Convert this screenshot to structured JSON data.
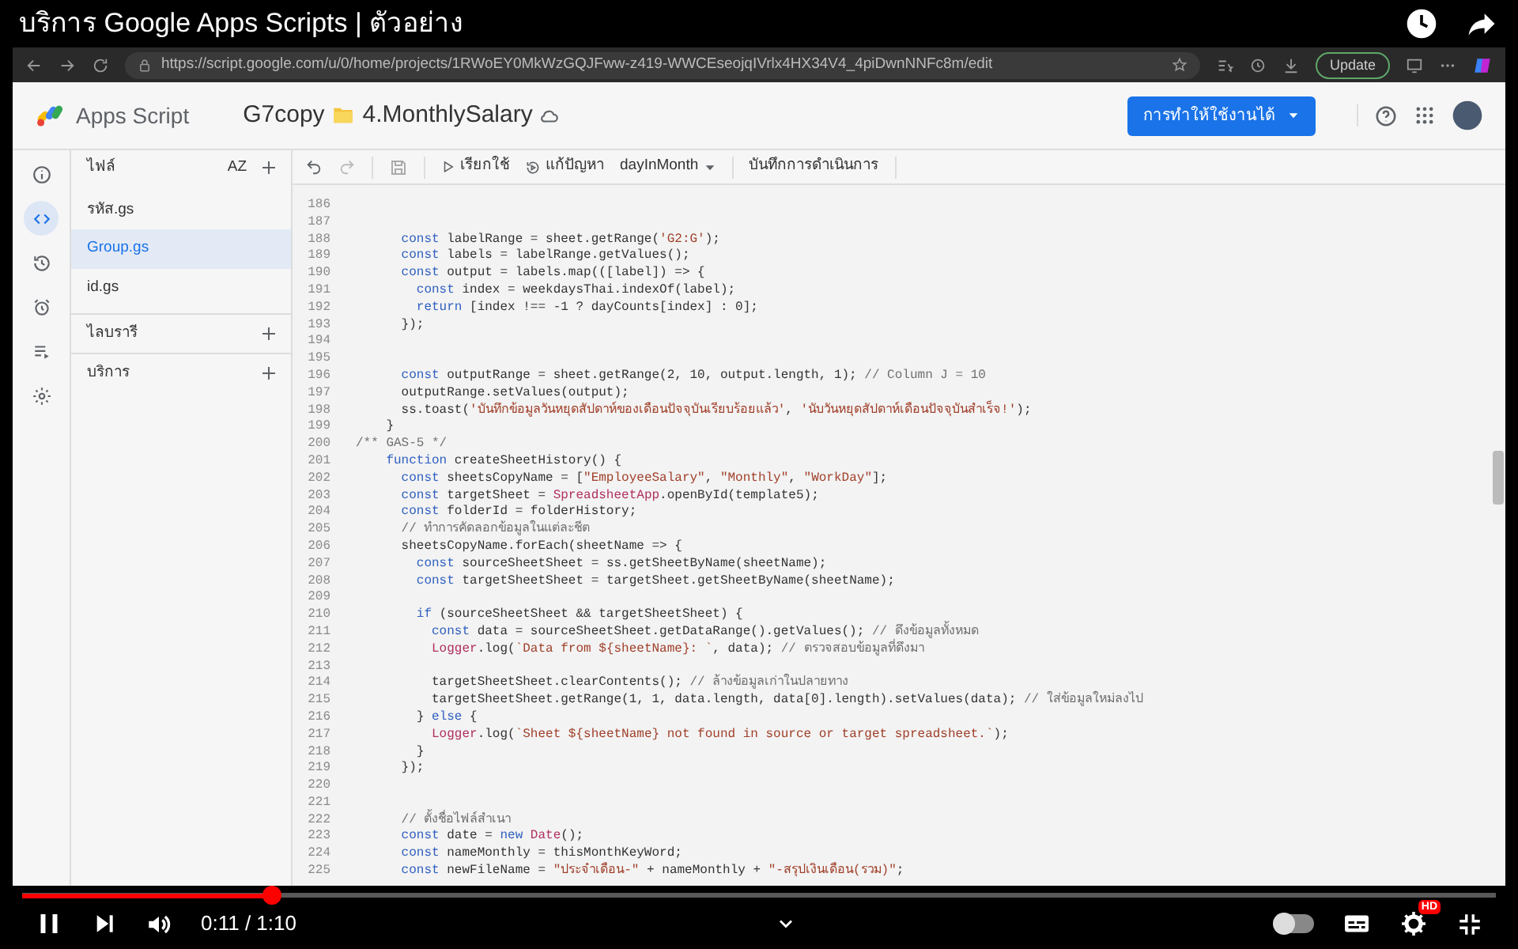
{
  "video": {
    "title": "บริการ Google Apps Scripts | ตัวอย่าง",
    "time": "0:11 / 1:10",
    "progress": {
      "level": 0.17
    },
    "autoplay": {
      "on": false
    },
    "hd_badge": "HD"
  },
  "browser": {
    "url": "https://script.google.com/u/0/home/projects/1RWoEY0MkWzGQJFww-z419-WWCEseojqIVrlx4HX34V4_4piDwnNNFc8m/edit",
    "update_button": "Update"
  },
  "app": {
    "product": "Apps Script",
    "project_prefix": "G7copy",
    "project_name": "4.MonthlySalary",
    "deploy_button": "การทำให้ใช้งานได้"
  },
  "rail": [
    {
      "kind": "overview",
      "selected": false
    },
    {
      "kind": "editor",
      "selected": true
    },
    {
      "kind": "history",
      "selected": false
    },
    {
      "kind": "triggers",
      "selected": false
    },
    {
      "kind": "executions",
      "selected": false
    },
    {
      "kind": "settings",
      "selected": false
    }
  ],
  "files": {
    "heading": "ไฟล์",
    "sort_button": "AZ",
    "items": [
      {
        "name": "รหัส.gs",
        "selected": false
      },
      {
        "name": "Group.gs",
        "selected": true
      },
      {
        "name": "id.gs",
        "selected": false
      }
    ],
    "sections": [
      {
        "label": "ไลบรารี"
      },
      {
        "label": "บริการ"
      }
    ]
  },
  "toolbar": {
    "run": "เรียกใช้",
    "debug": "แก้ปัญหา",
    "function": "dayInMonth",
    "log": "บันทึกการดำเนินการ"
  },
  "code": [
    {
      "n": "186"
    },
    {
      "n": "187"
    },
    {
      "n": "188",
      "parts": [
        {
          "kind": "keyword",
          "text": "      const"
        },
        {
          "kind": "plain",
          "text": " labelRange = sheet.getRange("
        },
        {
          "kind": "string",
          "text": "'G2:G'"
        },
        {
          "kind": "plain",
          "text": ");"
        }
      ]
    },
    {
      "n": "189",
      "parts": [
        {
          "kind": "keyword",
          "text": "      const"
        },
        {
          "kind": "plain",
          "text": " labels = labelRange.getValues();"
        }
      ]
    },
    {
      "n": "190",
      "parts": [
        {
          "kind": "keyword",
          "text": "      const"
        },
        {
          "kind": "plain",
          "text": " output = labels.map(([label]) => {"
        }
      ]
    },
    {
      "n": "191",
      "parts": [
        {
          "kind": "keyword",
          "text": "        const"
        },
        {
          "kind": "plain",
          "text": " index = weekdaysThai.indexOf(label);"
        }
      ]
    },
    {
      "n": "192",
      "parts": [
        {
          "kind": "keyword",
          "text": "        return"
        },
        {
          "kind": "plain",
          "text": " [index !== -1 ? dayCounts[index] : 0];"
        }
      ]
    },
    {
      "n": "193",
      "parts": [
        {
          "kind": "plain",
          "text": "      });"
        }
      ]
    },
    {
      "n": "194"
    },
    {
      "n": "195"
    },
    {
      "n": "196",
      "parts": [
        {
          "kind": "keyword",
          "text": "      const"
        },
        {
          "kind": "plain",
          "text": " outputRange = sheet.getRange(2, 10, output.length, 1); "
        },
        {
          "kind": "comment",
          "text": "// Column J = 10"
        }
      ]
    },
    {
      "n": "197",
      "parts": [
        {
          "kind": "plain",
          "text": "      outputRange.setValues(output);"
        }
      ]
    },
    {
      "n": "198",
      "parts": [
        {
          "kind": "plain",
          "text": "      ss.toast("
        },
        {
          "kind": "string",
          "text": "'บันทึกข้อมูลวันหยุดสัปดาห์ของเดือนปัจจุบันเรียบร้อยแล้ว'"
        },
        {
          "kind": "plain",
          "text": ", "
        },
        {
          "kind": "string",
          "text": "'นับวันหยุดสัปดาห์เดือนปัจจุบันสำเร็จ!'"
        },
        {
          "kind": "plain",
          "text": ");"
        }
      ]
    },
    {
      "n": "199",
      "parts": [
        {
          "kind": "plain",
          "text": "    }"
        }
      ]
    },
    {
      "n": "200",
      "parts": [
        {
          "kind": "comment",
          "text": "/** GAS-5 */"
        }
      ]
    },
    {
      "n": "201",
      "parts": [
        {
          "kind": "keyword",
          "text": "    function"
        },
        {
          "kind": "plain",
          "text": " createSheetHistory() {"
        }
      ]
    },
    {
      "n": "202",
      "parts": [
        {
          "kind": "keyword",
          "text": "      const"
        },
        {
          "kind": "plain",
          "text": " sheetsCopyName = ["
        },
        {
          "kind": "string",
          "text": "\"EmployeeSalary\""
        },
        {
          "kind": "plain",
          "text": ", "
        },
        {
          "kind": "string",
          "text": "\"Monthly\""
        },
        {
          "kind": "plain",
          "text": ", "
        },
        {
          "kind": "string",
          "text": "\"WorkDay\""
        },
        {
          "kind": "plain",
          "text": "];"
        }
      ]
    },
    {
      "n": "203",
      "parts": [
        {
          "kind": "keyword",
          "text": "      const"
        },
        {
          "kind": "plain",
          "text": " targetSheet = "
        },
        {
          "kind": "type",
          "text": "SpreadsheetApp"
        },
        {
          "kind": "plain",
          "text": ".openById(template5);"
        }
      ]
    },
    {
      "n": "204",
      "parts": [
        {
          "kind": "keyword",
          "text": "      const"
        },
        {
          "kind": "plain",
          "text": " folderId = folderHistory;"
        }
      ]
    },
    {
      "n": "205",
      "parts": [
        {
          "kind": "comment",
          "text": "      // ทำการคัดลอกข้อมูลในแต่ละชีต"
        }
      ]
    },
    {
      "n": "206",
      "parts": [
        {
          "kind": "plain",
          "text": "      sheetsCopyName.forEach(sheetName => {"
        }
      ]
    },
    {
      "n": "207",
      "parts": [
        {
          "kind": "keyword",
          "text": "        const"
        },
        {
          "kind": "plain",
          "text": " sourceSheetSheet = ss.getSheetByName(sheetName);"
        }
      ]
    },
    {
      "n": "208",
      "parts": [
        {
          "kind": "keyword",
          "text": "        const"
        },
        {
          "kind": "plain",
          "text": " targetSheetSheet = targetSheet.getSheetByName(sheetName);"
        }
      ]
    },
    {
      "n": "209"
    },
    {
      "n": "210",
      "parts": [
        {
          "kind": "keyword",
          "text": "        if"
        },
        {
          "kind": "plain",
          "text": " (sourceSheetSheet && targetSheetSheet) {"
        }
      ]
    },
    {
      "n": "211",
      "parts": [
        {
          "kind": "keyword",
          "text": "          const"
        },
        {
          "kind": "plain",
          "text": " data = sourceSheetSheet.getDataRange().getValues(); "
        },
        {
          "kind": "comment",
          "text": "// ดึงข้อมูลทั้งหมด"
        }
      ]
    },
    {
      "n": "212",
      "parts": [
        {
          "kind": "type",
          "text": "          Logger"
        },
        {
          "kind": "plain",
          "text": ".log("
        },
        {
          "kind": "string",
          "text": "`Data from ${sheetName}: `"
        },
        {
          "kind": "plain",
          "text": ", data); "
        },
        {
          "kind": "comment",
          "text": "// ตรวจสอบข้อมูลที่ดึงมา"
        }
      ]
    },
    {
      "n": "213"
    },
    {
      "n": "214",
      "parts": [
        {
          "kind": "plain",
          "text": "          targetSheetSheet.clearContents(); "
        },
        {
          "kind": "comment",
          "text": "// ล้างข้อมูลเก่าในปลายทาง"
        }
      ]
    },
    {
      "n": "215",
      "parts": [
        {
          "kind": "plain",
          "text": "          targetSheetSheet.getRange(1, 1, data.length, data[0].length).setValues(data); "
        },
        {
          "kind": "comment",
          "text": "// ใส่ข้อมูลใหม่ลงไป"
        }
      ]
    },
    {
      "n": "216",
      "parts": [
        {
          "kind": "plain",
          "text": "        } "
        },
        {
          "kind": "keyword",
          "text": "else"
        },
        {
          "kind": "plain",
          "text": " {"
        }
      ]
    },
    {
      "n": "217",
      "parts": [
        {
          "kind": "type",
          "text": "          Logger"
        },
        {
          "kind": "plain",
          "text": ".log("
        },
        {
          "kind": "string",
          "text": "`Sheet ${sheetName} not found in source or target spreadsheet.`"
        },
        {
          "kind": "plain",
          "text": ");"
        }
      ]
    },
    {
      "n": "218",
      "parts": [
        {
          "kind": "plain",
          "text": "        }"
        }
      ]
    },
    {
      "n": "219",
      "parts": [
        {
          "kind": "plain",
          "text": "      });"
        }
      ]
    },
    {
      "n": "220"
    },
    {
      "n": "221"
    },
    {
      "n": "222",
      "parts": [
        {
          "kind": "comment",
          "text": "      // ตั้งชื่อไฟล์สำเนา"
        }
      ]
    },
    {
      "n": "223",
      "parts": [
        {
          "kind": "keyword",
          "text": "      const"
        },
        {
          "kind": "plain",
          "text": " date = "
        },
        {
          "kind": "keyword",
          "text": "new"
        },
        {
          "kind": "type",
          "text": " Date"
        },
        {
          "kind": "plain",
          "text": "();"
        }
      ]
    },
    {
      "n": "224",
      "parts": [
        {
          "kind": "keyword",
          "text": "      const"
        },
        {
          "kind": "plain",
          "text": " nameMonthly = thisMonthKeyWord;"
        }
      ]
    },
    {
      "n": "225",
      "parts": [
        {
          "kind": "keyword",
          "text": "      const"
        },
        {
          "kind": "plain",
          "text": " newFileName = "
        },
        {
          "kind": "string",
          "text": "\"ประจำเดือน-\""
        },
        {
          "kind": "plain",
          "text": " + nameMonthly + "
        },
        {
          "kind": "string",
          "text": "\"-สรุปเงินเดือน(รวม)\""
        },
        {
          "kind": "plain",
          "text": ";"
        }
      ]
    }
  ]
}
